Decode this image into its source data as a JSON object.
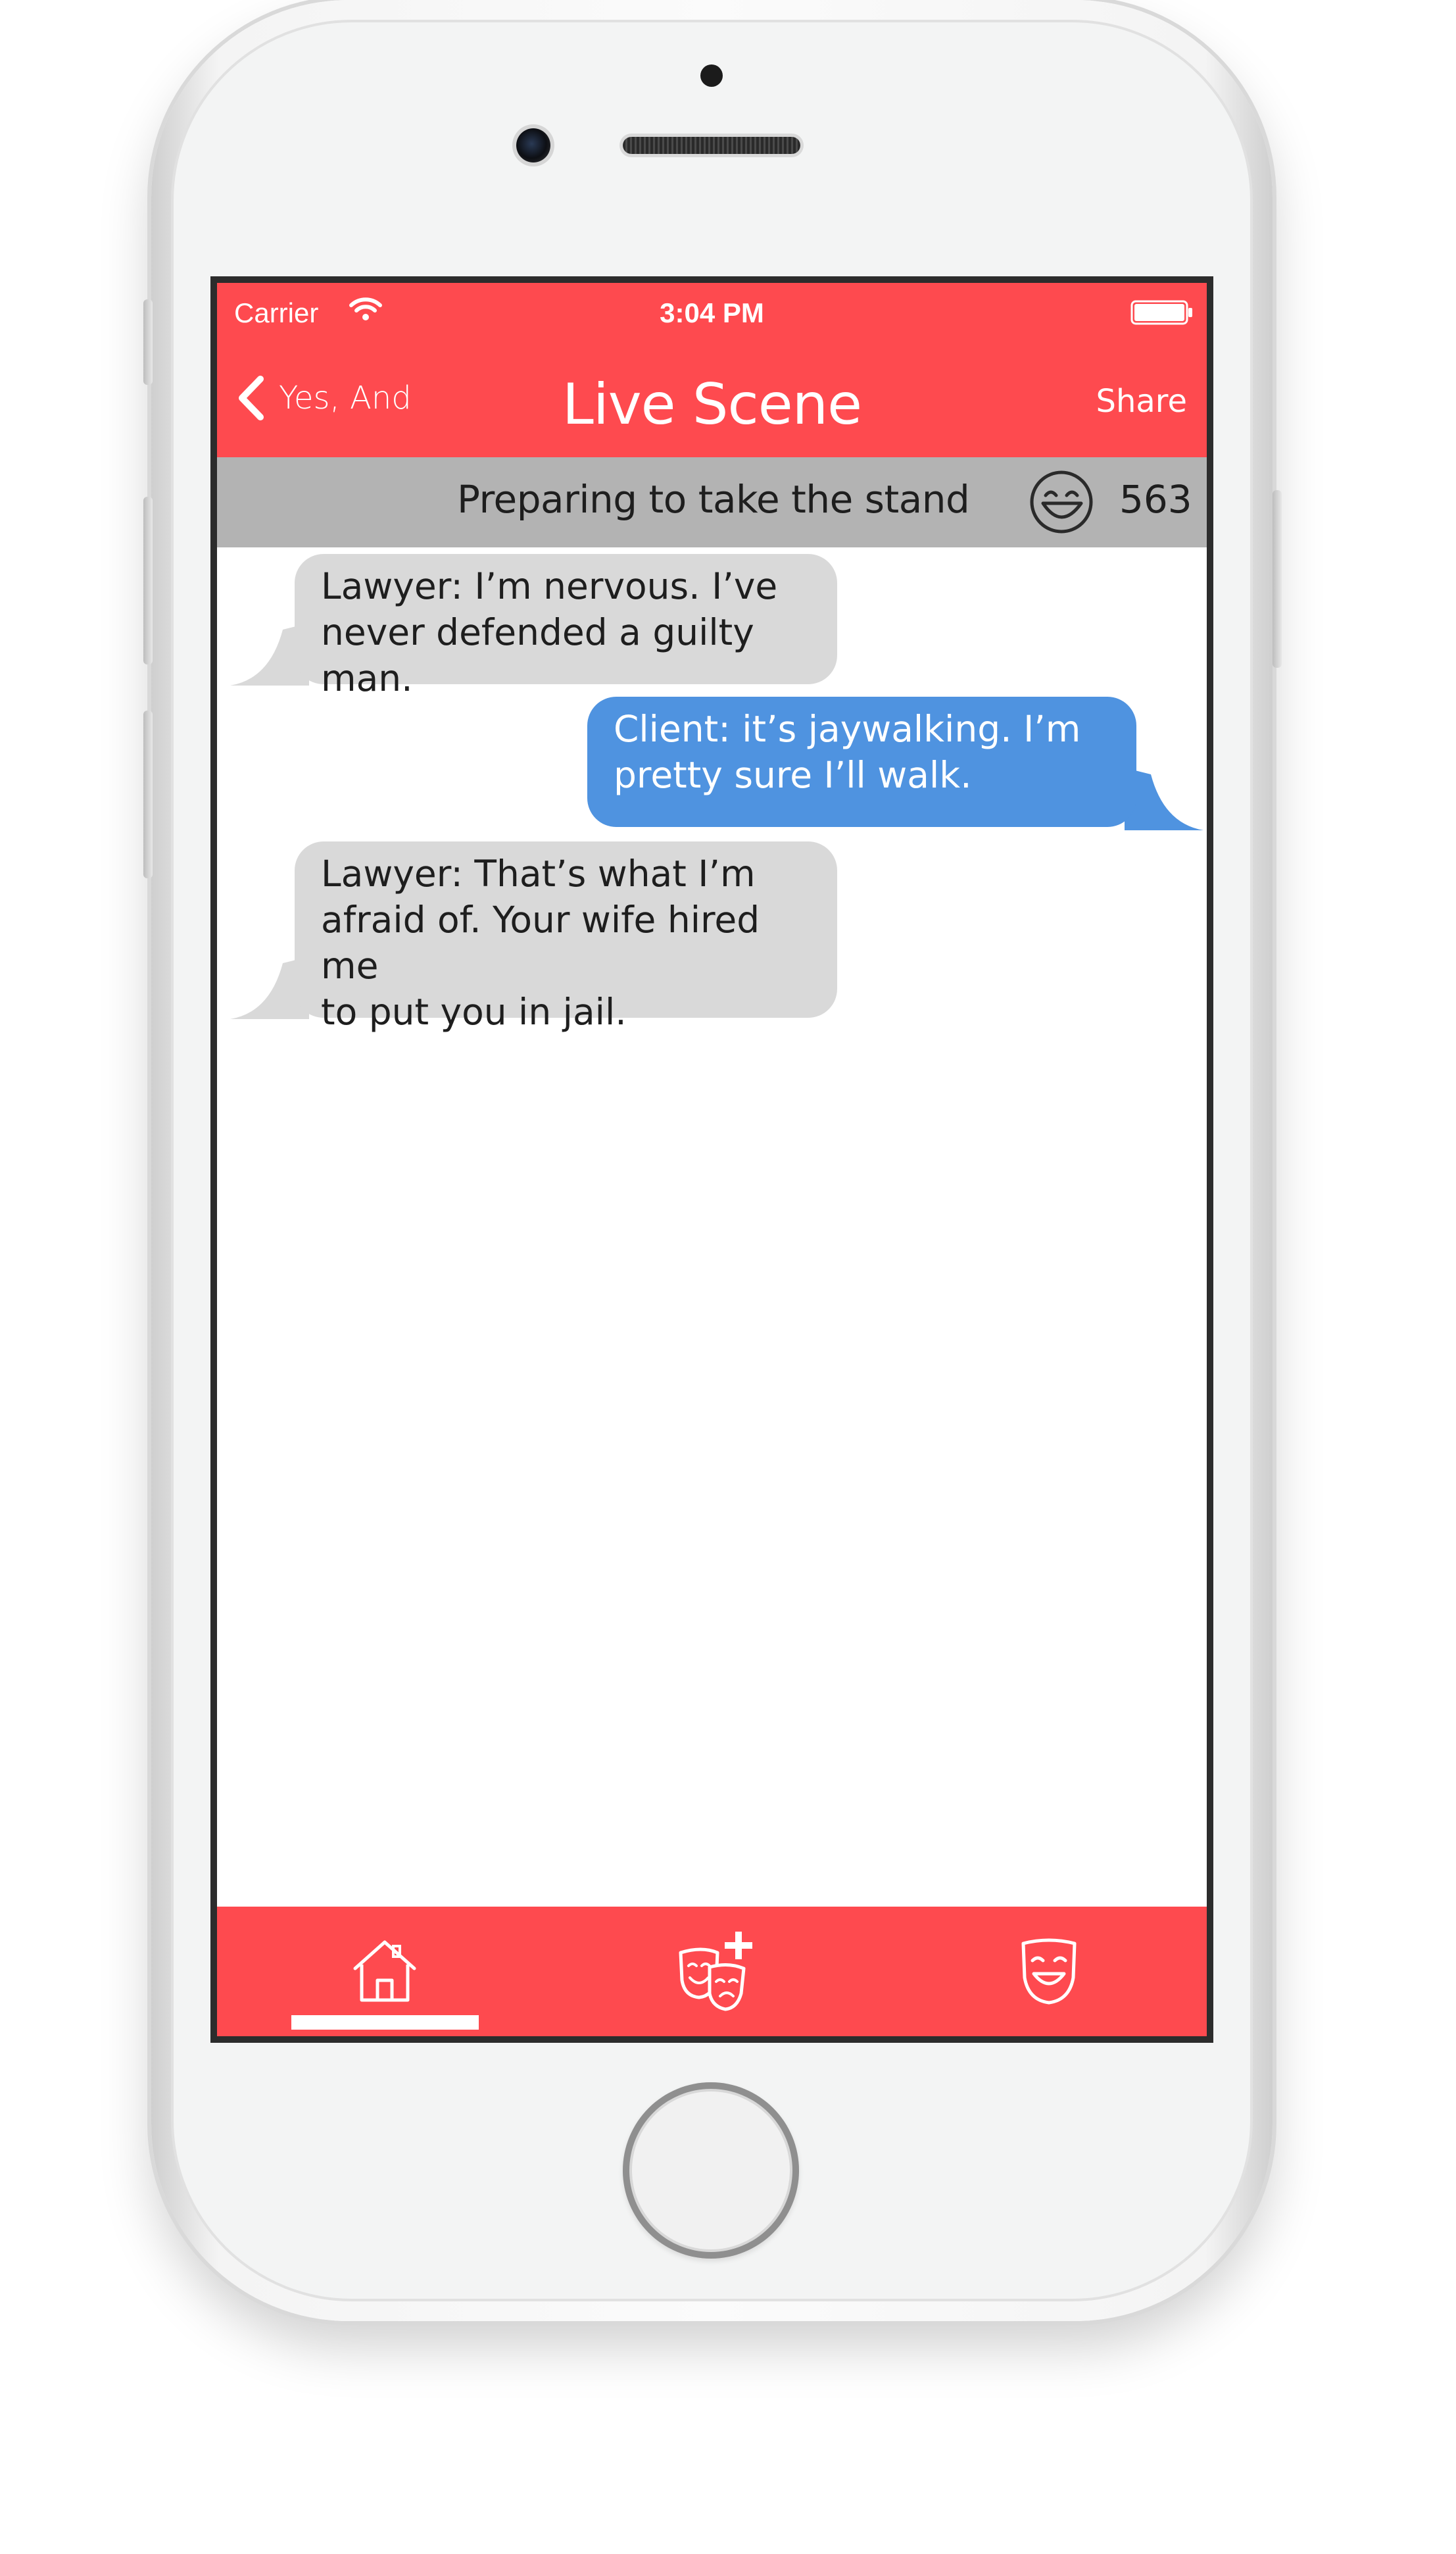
{
  "status_bar": {
    "carrier": "Carrier",
    "time": "3:04 PM",
    "wifi_icon": "wifi-icon",
    "battery_icon": "battery-full-icon"
  },
  "nav": {
    "back_label": "Yes, And",
    "back_icon": "chevron-left-icon",
    "title": "Live Scene",
    "share_label": "Share"
  },
  "scene": {
    "title": "Preparing to take the stand",
    "laugh_icon": "laughing-face-icon",
    "laugh_count": "563"
  },
  "messages": [
    {
      "direction": "incoming",
      "lines": [
        "Lawyer: I’m nervous. I’ve",
        "never defended a guilty man."
      ]
    },
    {
      "direction": "outgoing",
      "lines": [
        "Client: it’s jaywalking. I’m",
        "pretty sure I’ll walk."
      ]
    },
    {
      "direction": "incoming",
      "lines": [
        "Lawyer: That’s what I’m",
        "afraid of. Your wife hired me",
        "to put you in jail."
      ]
    }
  ],
  "tabs": [
    {
      "icon": "home-icon",
      "selected": true
    },
    {
      "icon": "add-scene-masks-icon",
      "selected": false
    },
    {
      "icon": "comedy-mask-icon",
      "selected": false
    }
  ],
  "colors": {
    "accent": "#fe4a4f",
    "scene_bar": "#b3b3b3",
    "incoming_bubble": "#d9d9d9",
    "outgoing_bubble": "#4f93e0"
  }
}
